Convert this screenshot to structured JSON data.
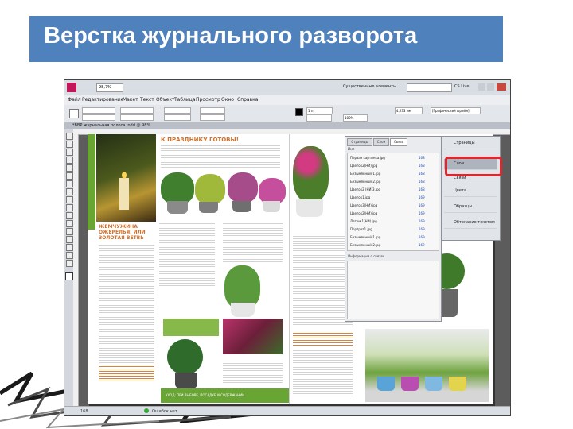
{
  "slide": {
    "title": "Верстка журнального разворота"
  },
  "app": {
    "zoom": "98,7%",
    "workspace": "Существенные элементы",
    "cs_live": "CS Live"
  },
  "menu": {
    "items": [
      "Файл",
      "Редактирование",
      "Макет",
      "Текст",
      "Объект",
      "Таблица",
      "Просмотр",
      "Окно",
      "Справка"
    ]
  },
  "control_bar": {
    "stroke_weight": "1 пт",
    "percent": "100%",
    "size": "4,233 мм",
    "frame_style": "[Графический фрейм]"
  },
  "document": {
    "tab": "*ВВР журнальная полоса.indd @ 98%"
  },
  "spread": {
    "headline_left": "К ПРАЗДНИКУ ГОТОВЫ!",
    "section_title": "ЖЕМЧУЖИНА ОЖЕРЕЛЬЯ, ИЛИ ЗОЛОТАЯ ВЕТВЬ",
    "green_text": "УХОД: ПРИ ВЫБОРЕ, ПОСАДКЕ И СОДЕРЖАНИИ"
  },
  "links_panel": {
    "tabs": [
      "Страницы",
      "Слои",
      "Связи"
    ],
    "header": "Имя",
    "info_header": "Информация о связях",
    "items": [
      {
        "name": "Первая картинка.jpg",
        "page": "168"
      },
      {
        "name": "Цветок2(НИ).jpg",
        "page": "168"
      },
      {
        "name": "Безымянный-1.jpg",
        "page": "168"
      },
      {
        "name": "Безымянный-2.jpg",
        "page": "168"
      },
      {
        "name": "Цветок2 (НИ)3.jpg",
        "page": "168"
      },
      {
        "name": "Цветок1.jpg",
        "page": "169"
      },
      {
        "name": "Цветок3(НИ).jpg",
        "page": "169"
      },
      {
        "name": "Цветок2(НИ).jpg",
        "page": "169"
      },
      {
        "name": "Летом 1(НИ).jpg",
        "page": "169"
      },
      {
        "name": "Портрет1.jpg",
        "page": "169"
      },
      {
        "name": "Безымянный-1.jpg",
        "page": "169"
      },
      {
        "name": "Безымянный-2.jpg",
        "page": "169"
      }
    ]
  },
  "side_panel": {
    "items": [
      "Страницы",
      "Слои",
      "Связи",
      "Цвета",
      "Образцы",
      "Обтекание текстом"
    ]
  },
  "status": {
    "page": "168",
    "preflight": "Ошибок нет"
  }
}
